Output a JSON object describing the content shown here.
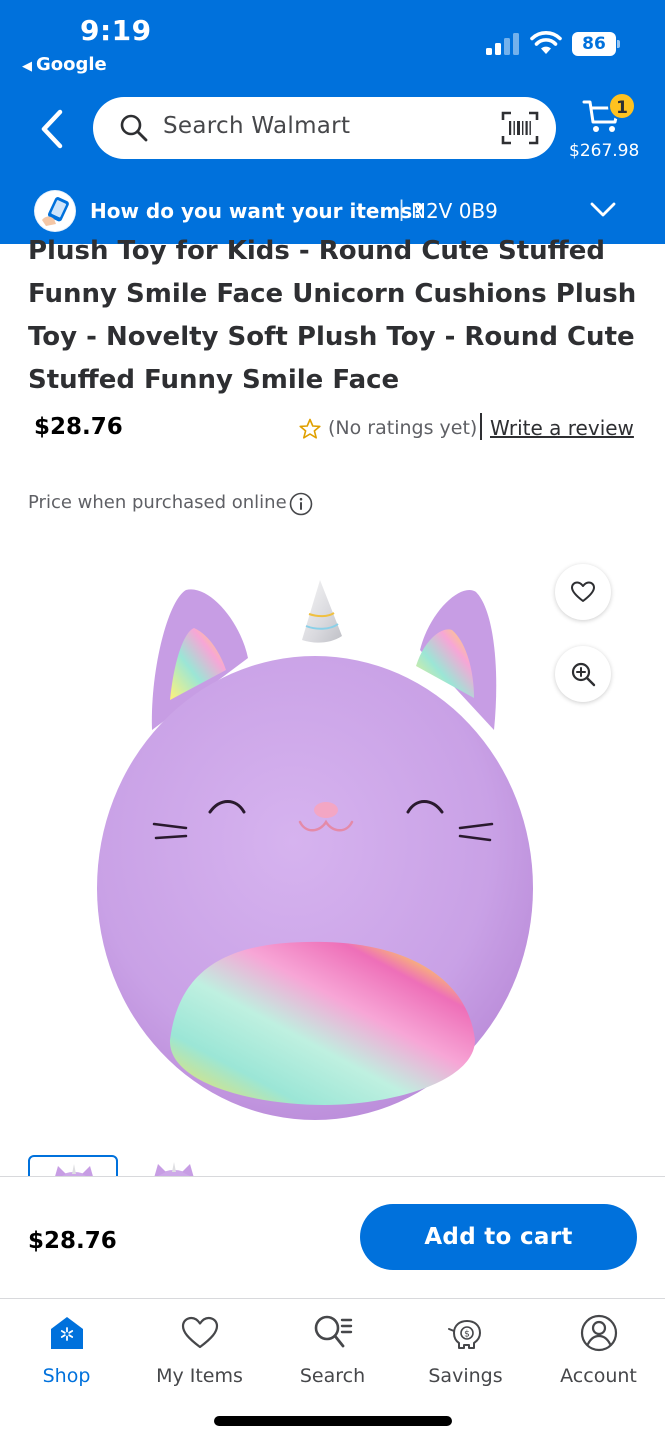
{
  "status_bar": {
    "time": "9:19",
    "back_app": "Google",
    "battery": "86"
  },
  "header": {
    "search_placeholder": "Search Walmart",
    "cart_count": "1",
    "cart_total": "$267.98",
    "delivery_question": "How do you want your items?",
    "delivery_separator": "|",
    "postal_code": "N2V 0B9",
    "brand_color": "#0071dc",
    "badge_color": "#ffc220"
  },
  "product": {
    "title": "Plush Toy for Kids - Round Cute Stuffed Funny Smile Face Unicorn Cushions Plush Toy - Novelty Soft Plush Toy - Round Cute Stuffed Funny Smile Face",
    "price": "$28.76",
    "rating_text": "(No ratings yet)",
    "write_review": "Write a review",
    "price_note": "Price when purchased online"
  },
  "sticky": {
    "price": "$28.76",
    "add_to_cart": "Add to cart"
  },
  "nav": {
    "items": [
      {
        "label": "Shop",
        "icon": "shop-icon",
        "active": true
      },
      {
        "label": "My Items",
        "icon": "heart-icon",
        "active": false
      },
      {
        "label": "Search",
        "icon": "search-list-icon",
        "active": false
      },
      {
        "label": "Savings",
        "icon": "piggy-bank-icon",
        "active": false
      },
      {
        "label": "Account",
        "icon": "account-icon",
        "active": false
      }
    ]
  }
}
